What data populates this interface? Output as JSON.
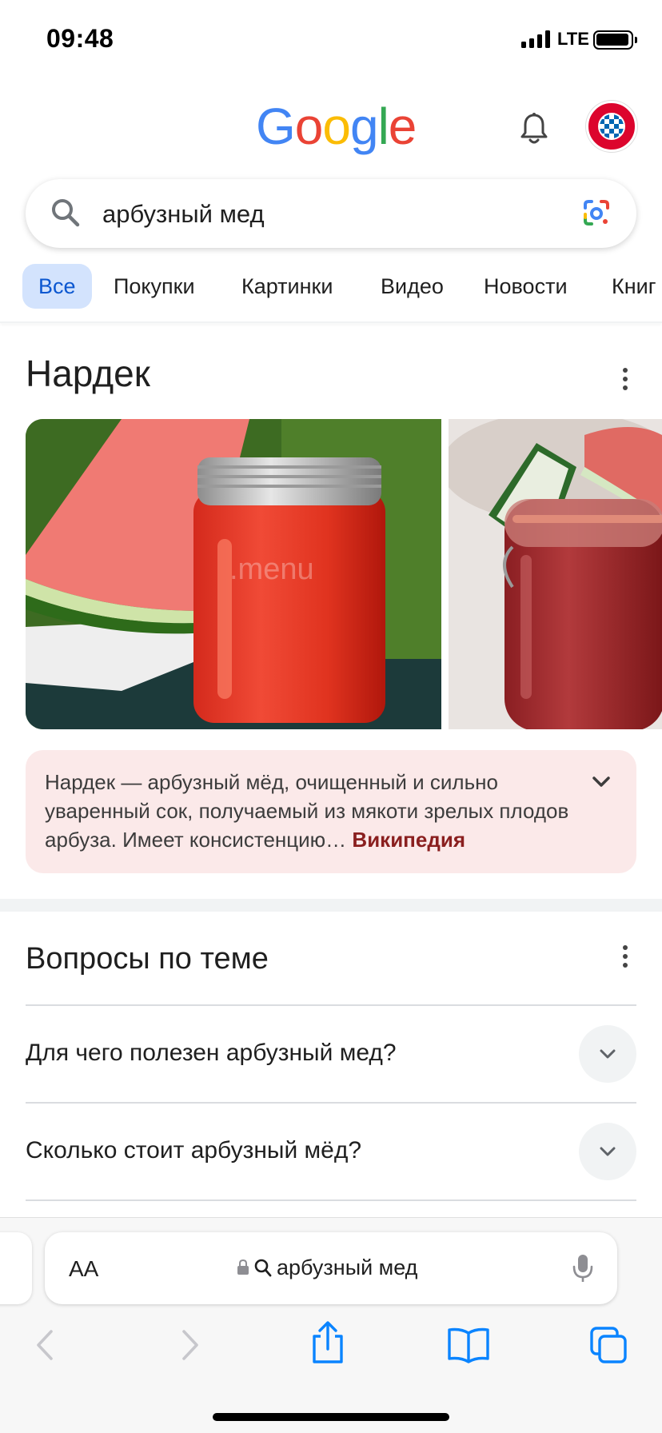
{
  "status_bar": {
    "time": "09:48",
    "network": "LTE"
  },
  "header": {
    "logo_letters": [
      "G",
      "o",
      "o",
      "g",
      "l",
      "e"
    ],
    "notifications_icon": "bell-icon",
    "avatar_icon": "fc-bayern-avatar"
  },
  "search": {
    "query": "арбузный мед",
    "icon": "search-icon",
    "lens_icon": "google-lens-icon"
  },
  "tabs": [
    {
      "label": "Все",
      "active": true
    },
    {
      "label": "Покупки",
      "active": false
    },
    {
      "label": "Картинки",
      "active": false
    },
    {
      "label": "Видео",
      "active": false
    },
    {
      "label": "Новости",
      "active": false
    },
    {
      "label": "Книг",
      "active": false
    }
  ],
  "knowledge": {
    "title": "Нардек",
    "image1_watermark": ".menu",
    "description": "Нардек — арбузный мёд, очищенный и сильно уваренный сок, получаемый из мякоти зрелых плодов арбуза. Имеет консистенцию…",
    "source": "Википедия"
  },
  "questions": {
    "title": "Вопросы по теме",
    "items": [
      "Для чего полезен арбузный мед?",
      "Сколько стоит арбузный мёд?"
    ]
  },
  "safari": {
    "text_size_label": "AA",
    "url_text": "арбузный мед",
    "mic_icon": "microphone-icon",
    "toolbar_icons": [
      "back-icon",
      "forward-icon",
      "share-icon",
      "bookmarks-icon",
      "tabs-icon"
    ]
  },
  "colors": {
    "google_blue": "#4285F4",
    "google_red": "#EA4335",
    "google_yellow": "#FBBC05",
    "google_green": "#34A853",
    "active_tab_bg": "#d3e3fd",
    "wiki_bg": "#fbe9e9",
    "wiki_link": "#8a1f1f",
    "ios_blue": "#0a84ff"
  }
}
